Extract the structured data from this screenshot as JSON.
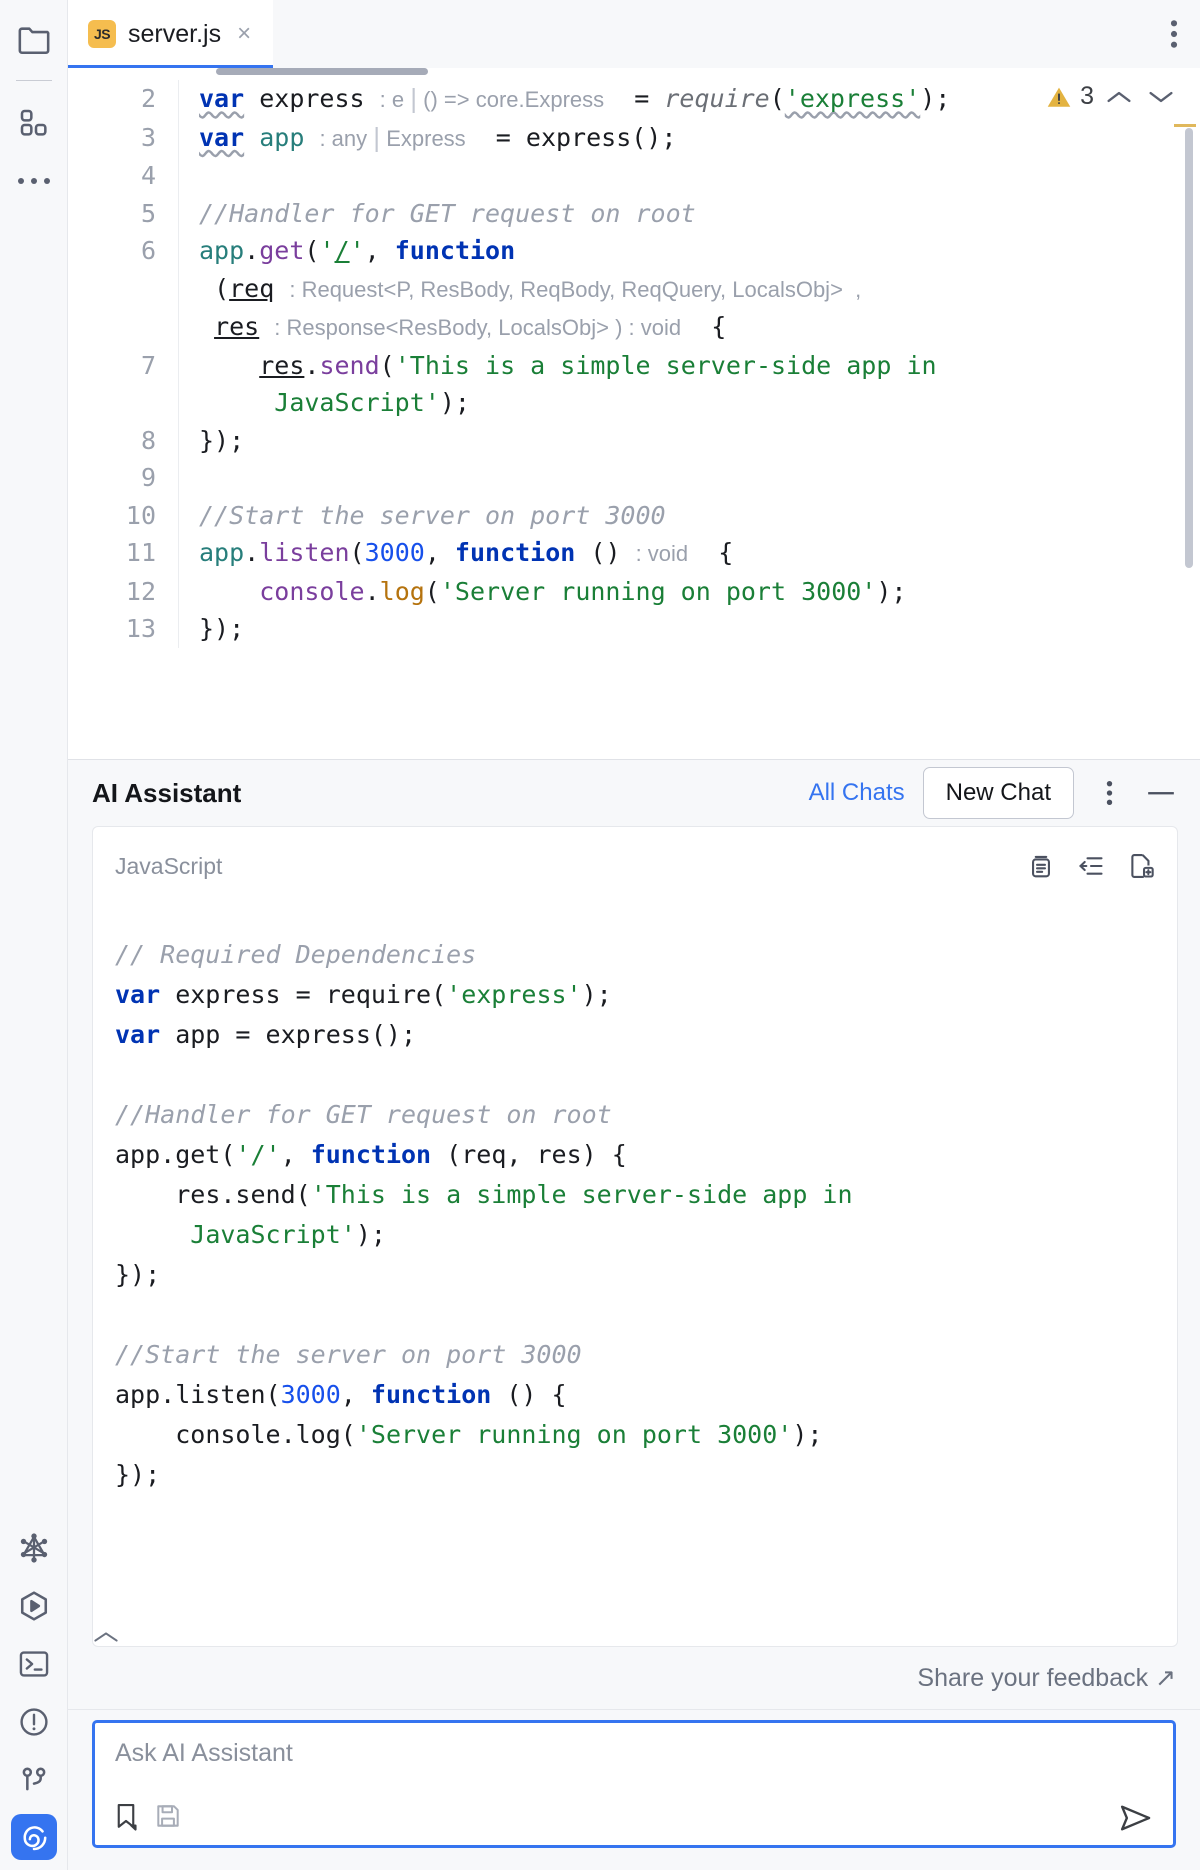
{
  "rail": {
    "items": [
      {
        "name": "project-folder",
        "icon": "folder-icon",
        "label": "Project"
      },
      {
        "name": "structure",
        "icon": "blocks-icon",
        "label": "Structure"
      },
      {
        "name": "more-tools",
        "icon": "more-dots-icon",
        "label": "More tool windows"
      },
      {
        "name": "graphql",
        "icon": "graphql-icon",
        "label": "GraphQL"
      },
      {
        "name": "run",
        "icon": "run-hexagon-icon",
        "label": "Run"
      },
      {
        "name": "terminal",
        "icon": "terminal-icon",
        "label": "Terminal"
      },
      {
        "name": "problems",
        "icon": "warning-circle-icon",
        "label": "Problems"
      },
      {
        "name": "version-control",
        "icon": "git-branch-icon",
        "label": "Version Control"
      },
      {
        "name": "ai-assistant",
        "icon": "ai-swirl-icon",
        "label": "AI Assistant"
      }
    ]
  },
  "tab": {
    "badge": "JS",
    "title": "server.js",
    "close": "×",
    "menu_icon": "vertical-dots-icon"
  },
  "editor": {
    "inspection": {
      "icon": "warning-triangle-icon",
      "count": "3",
      "up": "⌃",
      "down": "⌄"
    },
    "lines": [
      {
        "n": "2"
      },
      {
        "n": "3"
      },
      {
        "n": "4"
      },
      {
        "n": "5"
      },
      {
        "n": "6"
      },
      {
        "n": ""
      },
      {
        "n": ""
      },
      {
        "n": "7"
      },
      {
        "n": ""
      },
      {
        "n": "8"
      },
      {
        "n": "9"
      },
      {
        "n": "10"
      },
      {
        "n": "11"
      },
      {
        "n": "12"
      },
      {
        "n": "13"
      }
    ],
    "text": {
      "l2_kw": "var",
      "l2_name": "express",
      "l2_hint_type": ": e",
      "l2_hint_sig": "() => core.Express",
      "l2_eq": "=",
      "l2_require": "require",
      "l2_arg": "'express'",
      "l2_tail": ");",
      "l3_kw": "var",
      "l3_name": "app",
      "l3_hint_type": ": any",
      "l3_hint_sig": "Express",
      "l3_rest": "= express();",
      "l5_comment": "//Handler for GET request on root",
      "l6_obj": "app",
      "l6_dot": ".",
      "l6_method": "get",
      "l6_open": "(",
      "l6_path": "'/'",
      "l6_comma": ", ",
      "l6_function": "function",
      "l6b_open": "(",
      "l6b_req": "req",
      "l6b_reqtype": ": Request<P, ResBody, ReqBody, ReqQuery, LocalsObj>  ,",
      "l6c_res": "res",
      "l6c_restype": ": Response<ResBody, LocalsObj> ) : void",
      "l6c_brace": "{",
      "l7_res": "res",
      "l7_dot": ".",
      "l7_send": "send",
      "l7_open": "(",
      "l7_str1": "'This is a simple server-side app in",
      "l7_str2": "JavaScript'",
      "l7_tail": ");",
      "l8": "});",
      "l10_comment": "//Start the server on port 3000",
      "l11_obj": "app",
      "l11_dot": ".",
      "l11_listen": "listen",
      "l11_open": "(",
      "l11_port": "3000",
      "l11_comma": ", ",
      "l11_function": "function",
      "l11_parens": "()",
      "l11_hint": ": void",
      "l11_brace": "{",
      "l12_obj": "console",
      "l12_dot": ".",
      "l12_log": "log",
      "l12_open": "(",
      "l12_str": "'Server running on port 3000'",
      "l12_tail": ");",
      "l13": "});"
    }
  },
  "ai": {
    "title": "AI Assistant",
    "all_chats": "All Chats",
    "new_chat": "New Chat",
    "options_icon": "vertical-dots-icon",
    "minimize_icon": "minimize-icon",
    "code_card": {
      "language": "JavaScript",
      "actions": [
        {
          "name": "copy-snippet-button",
          "icon": "copy-icon"
        },
        {
          "name": "insert-at-caret-button",
          "icon": "insert-icon"
        },
        {
          "name": "create-file-button",
          "icon": "new-file-icon"
        }
      ],
      "lines": [
        {
          "t": "comment",
          "v": "// Required Dependencies"
        },
        {
          "t": "code",
          "v": "var express = require('express');"
        },
        {
          "t": "code",
          "v": "var app = express();"
        },
        {
          "t": "blank",
          "v": ""
        },
        {
          "t": "comment",
          "v": "//Handler for GET request on root"
        },
        {
          "t": "code",
          "v": "app.get('/', function (req, res) {"
        },
        {
          "t": "code",
          "v": "    res.send('This is a simple server-side app in"
        },
        {
          "t": "code",
          "v": "     JavaScript');"
        },
        {
          "t": "code",
          "v": "});"
        },
        {
          "t": "blank",
          "v": ""
        },
        {
          "t": "comment",
          "v": "//Start the server on port 3000"
        },
        {
          "t": "code",
          "v": "app.listen(3000, function () {"
        },
        {
          "t": "code",
          "v": "    console.log('Server running on port 3000');"
        },
        {
          "t": "code",
          "v": "});"
        }
      ],
      "collapse_icon": "chevron-up-icon"
    },
    "feedback": "Share your feedback ↗",
    "input": {
      "placeholder": "Ask AI Assistant",
      "value": "",
      "tools": [
        {
          "name": "attach-context-button",
          "icon": "bookmark-icon"
        },
        {
          "name": "save-prompt-button",
          "icon": "floppy-disk-icon"
        }
      ],
      "send_icon": "send-icon"
    }
  },
  "colors": {
    "accent": "#3574f0",
    "js_badge": "#f5bd4f",
    "keyword": "#0033b3",
    "string": "#1a7f37",
    "comment": "#9aa0ac",
    "method": "#7a3e9d",
    "panel_bg": "#f7f8fa"
  }
}
